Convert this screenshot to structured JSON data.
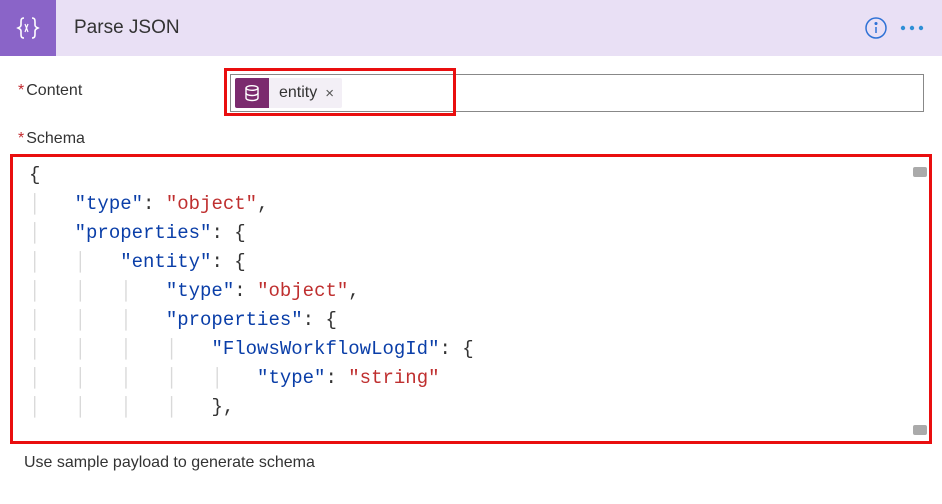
{
  "header": {
    "title": "Parse JSON",
    "icon": "braces-icon",
    "info_icon": "info-icon",
    "more_icon": "more-icon"
  },
  "fields": {
    "content": {
      "label": "Content",
      "required_marker": "*",
      "token": {
        "icon": "database-icon",
        "label": "entity",
        "close": "×"
      }
    },
    "schema": {
      "label": "Schema",
      "required_marker": "*",
      "code_lines": [
        {
          "indent": 0,
          "raw": "{"
        },
        {
          "indent": 1,
          "key": "\"type\"",
          "sep": ": ",
          "val": "\"object\"",
          "tail": ","
        },
        {
          "indent": 1,
          "key": "\"properties\"",
          "sep": ": ",
          "brace": "{"
        },
        {
          "indent": 2,
          "key": "\"entity\"",
          "sep": ": ",
          "brace": "{"
        },
        {
          "indent": 3,
          "key": "\"type\"",
          "sep": ": ",
          "val": "\"object\"",
          "tail": ","
        },
        {
          "indent": 3,
          "key": "\"properties\"",
          "sep": ": ",
          "brace": "{"
        },
        {
          "indent": 4,
          "key": "\"FlowsWorkflowLogId\"",
          "sep": ": ",
          "brace": "{"
        },
        {
          "indent": 5,
          "key": "\"type\"",
          "sep": ": ",
          "val": "\"string\""
        },
        {
          "indent": 4,
          "closebrace": "},",
          "tail": ""
        }
      ]
    }
  },
  "footer": {
    "generate_link": "Use sample payload to generate schema"
  },
  "colors": {
    "header_bg": "#e9e0f5",
    "header_icon_bg": "#8a64c8",
    "token_icon_bg": "#7b2b6e",
    "highlight": "#e90e0f",
    "json_key": "#0a3ea8",
    "json_string": "#bf2f2f"
  }
}
